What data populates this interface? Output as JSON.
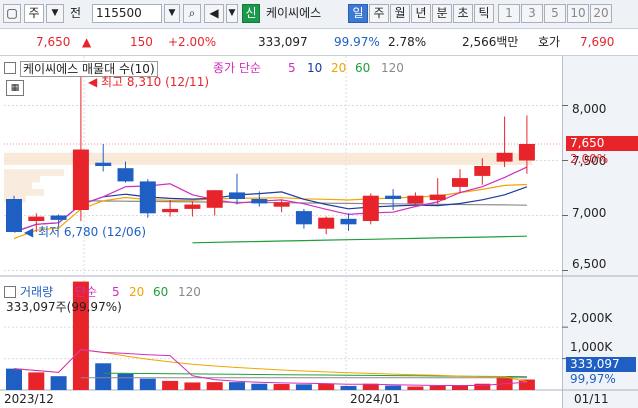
{
  "toolbar": {
    "market": "주",
    "prev_label": "전",
    "code": "115500",
    "new_badge": "신",
    "stock_name": "케이씨에스",
    "periods": [
      "일",
      "주",
      "월",
      "년",
      "분",
      "초",
      "틱"
    ],
    "active_period": "일",
    "numbers": [
      "1",
      "3",
      "5",
      "10",
      "20"
    ]
  },
  "quote": {
    "price": "7,650",
    "change": "150",
    "change_pct": "+2.00%",
    "volume": "333,097",
    "vol_ratio": "99.97%",
    "turnover": "2.78%",
    "amount": "2,566백만",
    "ask_label": "호가",
    "ask_price": "7,690"
  },
  "price_panel": {
    "legend_name": "케이씨에스 매물대 수(10)",
    "ma_label": "종가 단순",
    "ma_periods": [
      "5",
      "10",
      "20",
      "60",
      "120"
    ],
    "high_note": "최고 8,310 (12/11)",
    "low_note": "최저 6,780 (12/06)",
    "axis_ticks": [
      "8,000",
      "7,500",
      "7,000",
      "6,500"
    ],
    "last_price": "7,650",
    "last_pct": "2.00%"
  },
  "volume_panel": {
    "legend_name": "거래량",
    "ma_label": "단순",
    "ma_periods": [
      "5",
      "20",
      "60",
      "120"
    ],
    "current": "333,097주(99,97%)",
    "axis_ticks": [
      "2,000K",
      "1,000K"
    ],
    "last_volume": "333,097",
    "last_pct": "99,97%"
  },
  "xaxis": {
    "labels": [
      "2023/12",
      "2024/01",
      "01/11"
    ]
  },
  "colors": {
    "up": "#e8242b",
    "down": "#1f5fc4",
    "ma5": "#d12fbf",
    "ma10": "#1d3aa0",
    "ma20": "#f0a500",
    "ma60": "#1f9e3a",
    "ma120": "#8a8a8a"
  },
  "chart_data": {
    "type": "candlestick",
    "ylim": [
      6450,
      8450
    ],
    "candles": [
      {
        "o": 7150,
        "h": 7180,
        "l": 6850,
        "c": 6850
      },
      {
        "o": 6950,
        "h": 7020,
        "l": 6850,
        "c": 6990
      },
      {
        "o": 7000,
        "h": 7010,
        "l": 6900,
        "c": 6960
      },
      {
        "o": 7050,
        "h": 8310,
        "l": 6950,
        "c": 7600
      },
      {
        "o": 7480,
        "h": 7650,
        "l": 7400,
        "c": 7450
      },
      {
        "o": 7430,
        "h": 7490,
        "l": 7300,
        "c": 7310
      },
      {
        "o": 7310,
        "h": 7330,
        "l": 6980,
        "c": 7020
      },
      {
        "o": 7030,
        "h": 7140,
        "l": 6990,
        "c": 7060
      },
      {
        "o": 7060,
        "h": 7130,
        "l": 6990,
        "c": 7100
      },
      {
        "o": 7070,
        "h": 7230,
        "l": 7000,
        "c": 7230
      },
      {
        "o": 7210,
        "h": 7380,
        "l": 7100,
        "c": 7150
      },
      {
        "o": 7150,
        "h": 7220,
        "l": 7080,
        "c": 7110
      },
      {
        "o": 7080,
        "h": 7140,
        "l": 7030,
        "c": 7120
      },
      {
        "o": 7040,
        "h": 7060,
        "l": 6880,
        "c": 6920
      },
      {
        "o": 6880,
        "h": 6990,
        "l": 6830,
        "c": 6980
      },
      {
        "o": 6970,
        "h": 7020,
        "l": 6860,
        "c": 6920
      },
      {
        "o": 6950,
        "h": 7200,
        "l": 6920,
        "c": 7180
      },
      {
        "o": 7180,
        "h": 7240,
        "l": 7050,
        "c": 7150
      },
      {
        "o": 7110,
        "h": 7210,
        "l": 7090,
        "c": 7180
      },
      {
        "o": 7140,
        "h": 7340,
        "l": 7100,
        "c": 7190
      },
      {
        "o": 7260,
        "h": 7420,
        "l": 7200,
        "c": 7340
      },
      {
        "o": 7360,
        "h": 7520,
        "l": 7280,
        "c": 7450
      },
      {
        "o": 7490,
        "h": 7900,
        "l": 7440,
        "c": 7570
      },
      {
        "o": 7500,
        "h": 7910,
        "l": 7380,
        "c": 7650
      }
    ],
    "volumes": [
      680,
      560,
      440,
      3450,
      850,
      520,
      360,
      290,
      240,
      250,
      250,
      200,
      190,
      180,
      200,
      130,
      200,
      140,
      110,
      130,
      140,
      200,
      420,
      333
    ]
  }
}
